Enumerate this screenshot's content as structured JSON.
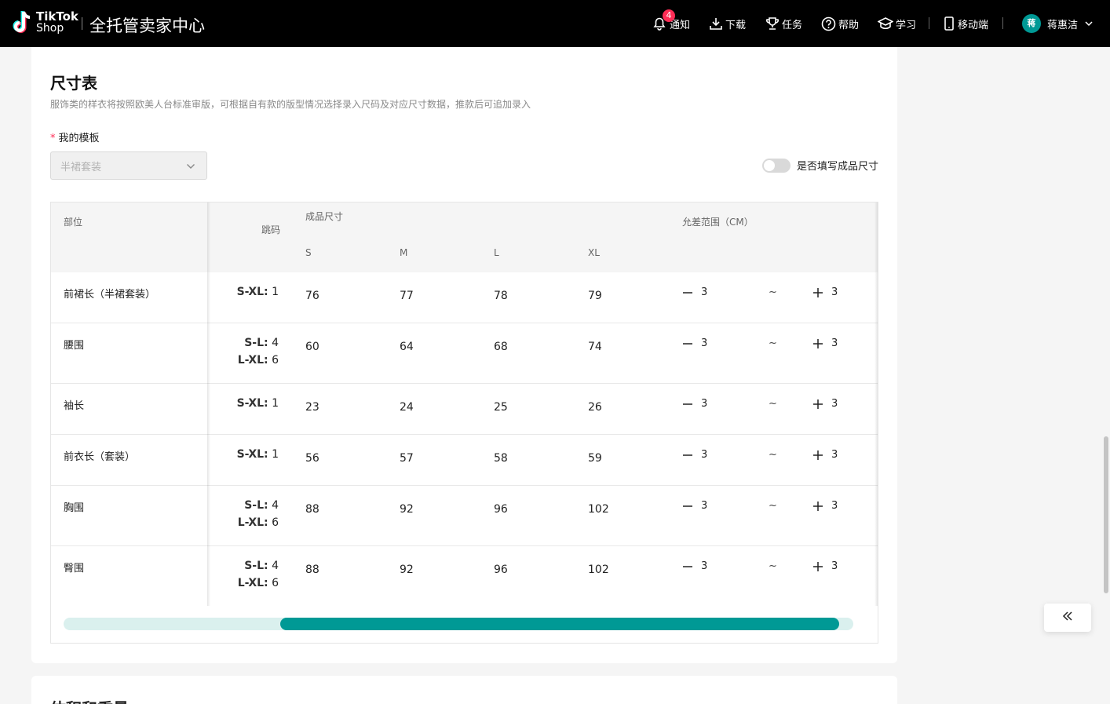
{
  "header": {
    "logo_line1": "TikTok",
    "logo_line2": "Shop",
    "portal_title": "全托管卖家中心",
    "nav": [
      {
        "icon": "bell-icon",
        "label": "通知",
        "badge": "4"
      },
      {
        "icon": "download-icon",
        "label": "下载"
      },
      {
        "icon": "trophy-icon",
        "label": "任务"
      },
      {
        "icon": "help-icon",
        "label": "帮助"
      },
      {
        "icon": "graduation-cap-icon",
        "label": "学习"
      },
      {
        "icon": "mobile-icon",
        "label": "移动端"
      }
    ],
    "user": {
      "avatar_text": "蒋",
      "name": "蒋惠洁"
    }
  },
  "size_section": {
    "title": "尺寸表",
    "description": "服饰类的样衣将按照欧美人台标准审版，可根据自有款的版型情况选择录入尺码及对应尺寸数据，推款后可追加录入",
    "template_label": "我的模板",
    "template_required_mark": "*",
    "template_value": "半裙套装",
    "toggle_label": "是否填写成品尺寸",
    "toggle_on": false
  },
  "table": {
    "headers": {
      "part": "部位",
      "size_range": "跳码",
      "finished_size": "成品尺寸",
      "tolerance": "允差范围（CM）",
      "sizes": [
        "S",
        "M",
        "L",
        "XL"
      ]
    },
    "rows": [
      {
        "part": "前裙长（半裙套装）",
        "ranges": [
          {
            "k": "S-XL:",
            "v": " 1"
          }
        ],
        "values": [
          "76",
          "77",
          "78",
          "79"
        ],
        "minus": "3",
        "tilde": "~",
        "plus": "3"
      },
      {
        "part": "腰围",
        "ranges": [
          {
            "k": "S-L:",
            "v": " 4"
          },
          {
            "k": "L-XL:",
            "v": " 6"
          }
        ],
        "values": [
          "60",
          "64",
          "68",
          "74"
        ],
        "minus": "3",
        "tilde": "~",
        "plus": "3"
      },
      {
        "part": "袖长",
        "ranges": [
          {
            "k": "S-XL:",
            "v": " 1"
          }
        ],
        "values": [
          "23",
          "24",
          "25",
          "26"
        ],
        "minus": "3",
        "tilde": "~",
        "plus": "3"
      },
      {
        "part": "前衣长（套装）",
        "ranges": [
          {
            "k": "S-XL:",
            "v": " 1"
          }
        ],
        "values": [
          "56",
          "57",
          "58",
          "59"
        ],
        "minus": "3",
        "tilde": "~",
        "plus": "3"
      },
      {
        "part": "胸围",
        "ranges": [
          {
            "k": "S-L:",
            "v": " 4"
          },
          {
            "k": "L-XL:",
            "v": " 6"
          }
        ],
        "values": [
          "88",
          "92",
          "96",
          "102"
        ],
        "minus": "3",
        "tilde": "~",
        "plus": "3"
      },
      {
        "part": "臀围",
        "ranges": [
          {
            "k": "S-L:",
            "v": " 4"
          },
          {
            "k": "L-XL:",
            "v": " 6"
          }
        ],
        "values": [
          "88",
          "92",
          "96",
          "102"
        ],
        "minus": "3",
        "tilde": "~",
        "plus": "3"
      }
    ]
  },
  "next_section": {
    "title": "体积和重量"
  },
  "colors": {
    "accent": "#009995",
    "badge": "#fe2c55"
  }
}
